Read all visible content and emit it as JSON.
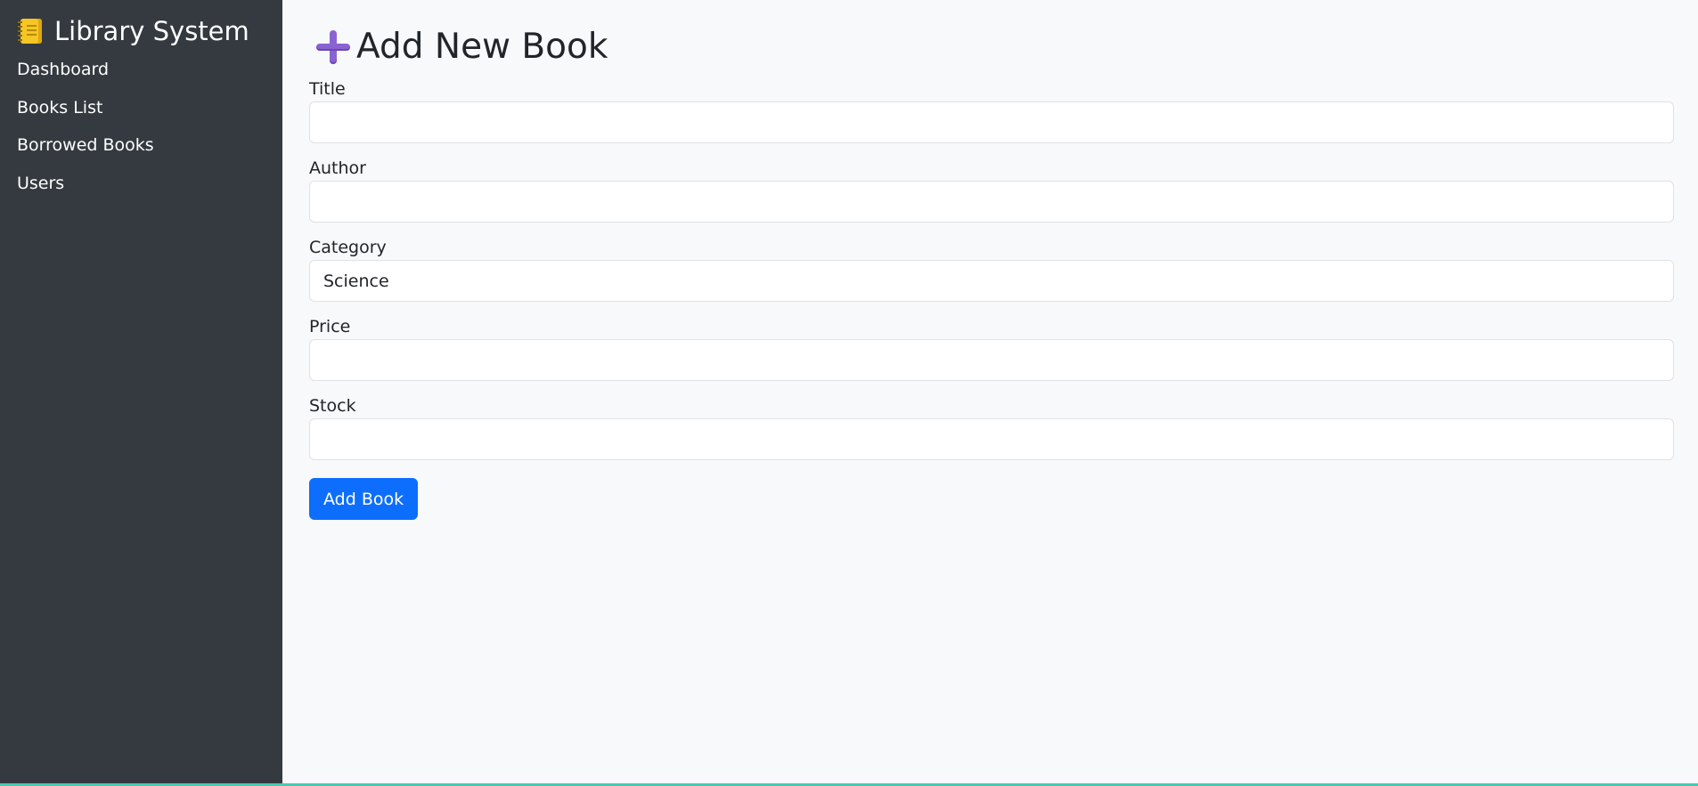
{
  "sidebar": {
    "brand": {
      "icon": "notebook-icon",
      "title": "Library System"
    },
    "items": [
      {
        "label": "Dashboard"
      },
      {
        "label": "Books List"
      },
      {
        "label": "Borrowed Books"
      },
      {
        "label": "Users"
      }
    ]
  },
  "main": {
    "title_icon": "plus-icon",
    "title": "Add New Book",
    "form": {
      "title_label": "Title",
      "title_value": "",
      "author_label": "Author",
      "author_value": "",
      "category_label": "Category",
      "category_value": "Science",
      "price_label": "Price",
      "price_value": "",
      "stock_label": "Stock",
      "stock_value": "",
      "submit_label": "Add Book"
    }
  },
  "colors": {
    "sidebar_bg": "#343a40",
    "main_bg": "#f8f9fa",
    "primary": "#0d6efd",
    "plus_icon": "#8a63d2"
  }
}
